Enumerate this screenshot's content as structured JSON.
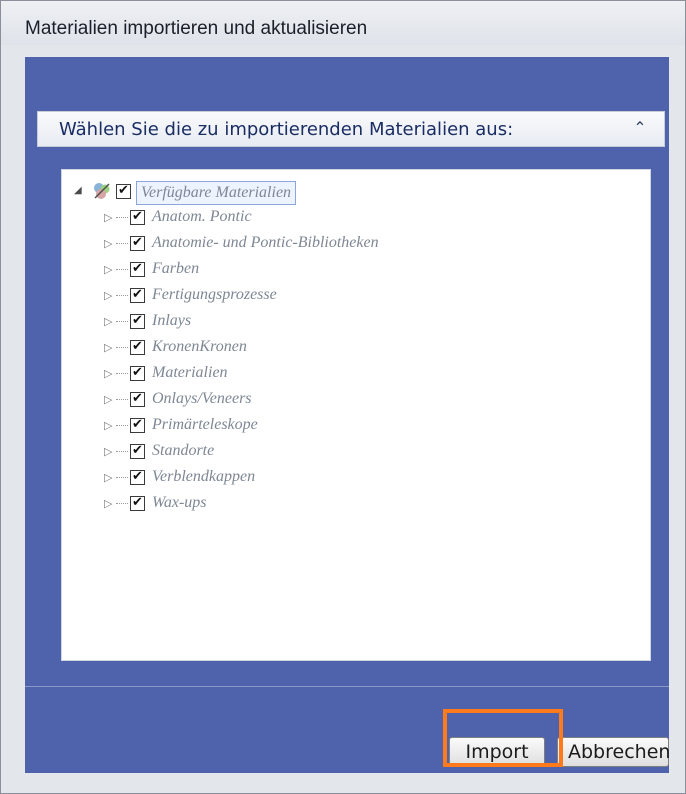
{
  "window": {
    "title": "Materialien importieren und aktualisieren"
  },
  "section": {
    "title": "Wählen Sie die zu importierenden Materialien aus:",
    "collapse_icon": "chevron-double-up-icon"
  },
  "tree": {
    "root": {
      "label": "Verfügbare Materialien",
      "checked": true,
      "expanded": true,
      "icon": "materials-icon"
    },
    "items": [
      {
        "label": "Anatom. Pontic",
        "checked": true,
        "expanded": false
      },
      {
        "label": "Anatomie- und Pontic-Bibliotheken",
        "checked": true,
        "expanded": false
      },
      {
        "label": "Farben",
        "checked": true,
        "expanded": false
      },
      {
        "label": "Fertigungsprozesse",
        "checked": true,
        "expanded": false
      },
      {
        "label": "Inlays",
        "checked": true,
        "expanded": false
      },
      {
        "label": "KronenKronen",
        "checked": true,
        "expanded": false
      },
      {
        "label": "Materialien",
        "checked": true,
        "expanded": false
      },
      {
        "label": "Onlays/Veneers",
        "checked": true,
        "expanded": false
      },
      {
        "label": "Primärteleskope",
        "checked": true,
        "expanded": false
      },
      {
        "label": "Standorte",
        "checked": true,
        "expanded": false
      },
      {
        "label": "Verblendkappen",
        "checked": true,
        "expanded": false
      },
      {
        "label": "Wax-ups",
        "checked": true,
        "expanded": false
      }
    ]
  },
  "buttons": {
    "import": "Import",
    "cancel": "Abbrechen"
  },
  "colors": {
    "panel_blue": "#4f63ad",
    "highlight_orange": "#ff7a1a",
    "item_text": "#7e8794"
  }
}
